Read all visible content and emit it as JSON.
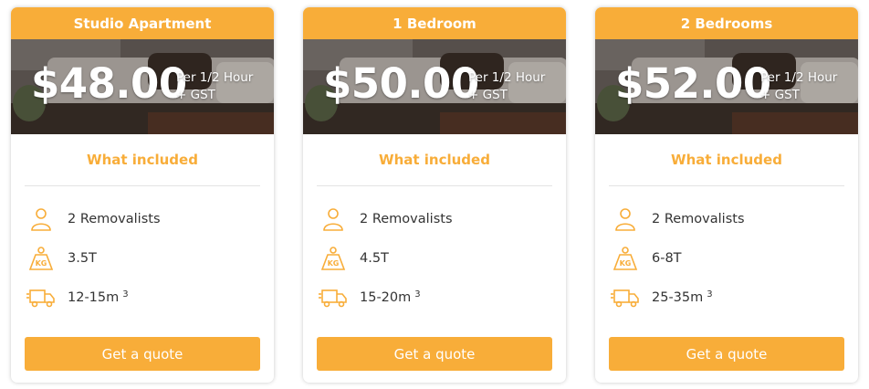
{
  "colors": {
    "accent": "#f8ad39",
    "text": "#333333",
    "divider": "#e3e3e3"
  },
  "plans": [
    {
      "title": "Studio Apartment",
      "price": "$48.00",
      "unit_line1": "Per 1/2 Hour",
      "unit_line2": "+ GST",
      "included_heading": "What included",
      "features": [
        {
          "icon": "person-icon",
          "text": "2 Removalists"
        },
        {
          "icon": "kg-weight-icon",
          "text": "3.5T"
        },
        {
          "icon": "moving-truck-icon",
          "text": "12-15m",
          "sup": "3"
        }
      ],
      "button_label": "Get a quote"
    },
    {
      "title": "1 Bedroom",
      "price": "$50.00",
      "unit_line1": "Per 1/2 Hour",
      "unit_line2": "+ GST",
      "included_heading": "What included",
      "features": [
        {
          "icon": "person-icon",
          "text": "2 Removalists"
        },
        {
          "icon": "kg-weight-icon",
          "text": "4.5T"
        },
        {
          "icon": "moving-truck-icon",
          "text": "15-20m",
          "sup": "3"
        }
      ],
      "button_label": "Get a quote"
    },
    {
      "title": "2 Bedrooms",
      "price": "$52.00",
      "unit_line1": "Per 1/2 Hour",
      "unit_line2": "+ GST",
      "included_heading": "What included",
      "features": [
        {
          "icon": "person-icon",
          "text": "2 Removalists"
        },
        {
          "icon": "kg-weight-icon",
          "text": "6-8T"
        },
        {
          "icon": "moving-truck-icon",
          "text": "25-35m",
          "sup": "3"
        }
      ],
      "button_label": "Get a quote"
    }
  ]
}
